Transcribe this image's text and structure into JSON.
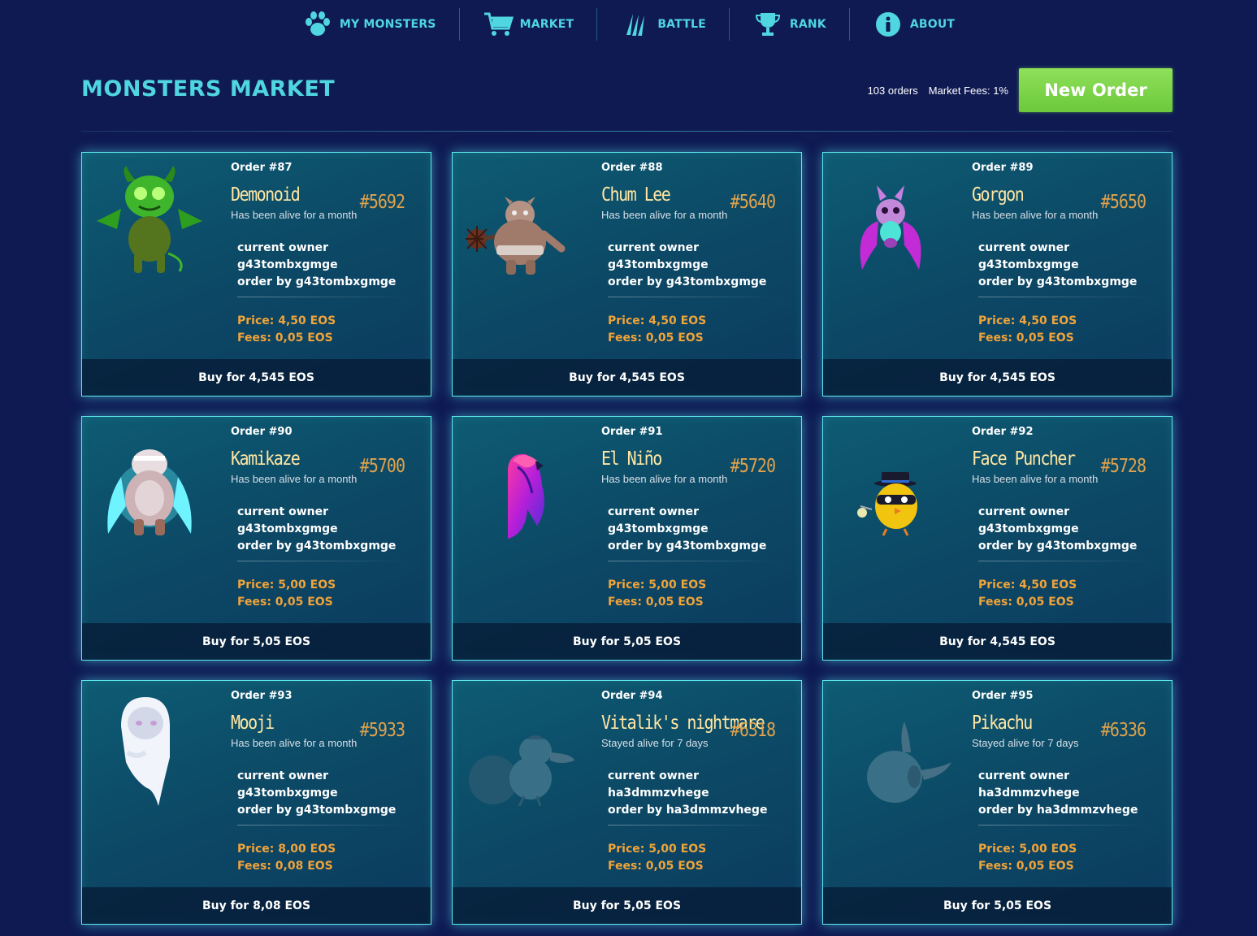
{
  "nav": {
    "items": [
      {
        "label": "MY MONSTERS",
        "icon": "paw-icon"
      },
      {
        "label": "MARKET",
        "icon": "cart-icon"
      },
      {
        "label": "BATTLE",
        "icon": "claw-icon"
      },
      {
        "label": "RANK",
        "icon": "trophy-icon"
      },
      {
        "label": "ABOUT",
        "icon": "info-icon"
      }
    ]
  },
  "header": {
    "title": "MONSTERS MARKET",
    "orders_count": "103 orders",
    "market_fees": "Market Fees: 1%",
    "new_order_label": "New Order"
  },
  "colors": {
    "background": "#0f1a52",
    "accent": "#4fd6e0",
    "name": "#ffe6a3",
    "price": "#f0a43a",
    "button": "#7ed44a"
  },
  "cards": [
    {
      "order": "Order #87",
      "name": "Demonoid",
      "id": "#5692",
      "alive": "Has been alive for a month",
      "owner_label": "current owner",
      "owner": "g43tombxgmge",
      "order_by": "order by g43tombxgmge",
      "price": "Price: 4,50 EOS",
      "fees": "Fees: 0,05 EOS",
      "buy": "Buy for 4,545 EOS",
      "art": "green-demon-monster"
    },
    {
      "order": "Order #88",
      "name": "Chum Lee",
      "id": "#5640",
      "alive": "Has been alive for a month",
      "owner_label": "current owner",
      "owner": "g43tombxgmge",
      "order_by": "order by g43tombxgmge",
      "price": "Price: 4,50 EOS",
      "fees": "Fees: 0,05 EOS",
      "buy": "Buy for 4,545 EOS",
      "art": "ogre-mace-monster"
    },
    {
      "order": "Order #89",
      "name": "Gorgon",
      "id": "#5650",
      "alive": "Has been alive for a month",
      "owner_label": "current owner",
      "owner": "g43tombxgmge",
      "order_by": "order by g43tombxgmge",
      "price": "Price: 4,50 EOS",
      "fees": "Fees: 0,05 EOS",
      "buy": "Buy for 4,545 EOS",
      "art": "purple-bat-monster"
    },
    {
      "order": "Order #90",
      "name": "Kamikaze",
      "id": "#5700",
      "alive": "Has been alive for a month",
      "owner_label": "current owner",
      "owner": "g43tombxgmge",
      "order_by": "order by g43tombxgmge",
      "price": "Price: 5,00 EOS",
      "fees": "Fees: 0,05 EOS",
      "buy": "Buy for 5,05 EOS",
      "art": "glowing-bear-monster"
    },
    {
      "order": "Order #91",
      "name": "El Niño",
      "id": "#5720",
      "alive": "Has been alive for a month",
      "owner_label": "current owner",
      "owner": "g43tombxgmge",
      "order_by": "order by g43tombxgmge",
      "price": "Price: 5,00 EOS",
      "fees": "Fees: 0,05 EOS",
      "buy": "Buy for 5,05 EOS",
      "art": "flame-bird-monster"
    },
    {
      "order": "Order #92",
      "name": "Face Puncher",
      "id": "#5728",
      "alive": "Has been alive for a month",
      "owner_label": "current owner",
      "owner": "g43tombxgmge",
      "order_by": "order by g43tombxgmge",
      "price": "Price: 4,50 EOS",
      "fees": "Fees: 0,05 EOS",
      "buy": "Buy for 4,545 EOS",
      "art": "masked-chick-monster"
    },
    {
      "order": "Order #93",
      "name": "Mooji",
      "id": "#5933",
      "alive": "Has been alive for a month",
      "owner_label": "current owner",
      "owner": "g43tombxgmge",
      "order_by": "order by g43tombxgmge",
      "price": "Price: 8,00 EOS",
      "fees": "Fees: 0,08 EOS",
      "buy": "Buy for 8,08 EOS",
      "art": "white-ghost-monster"
    },
    {
      "order": "Order #94",
      "name": "Vitalik's nightmare",
      "id": "#6318",
      "alive": "Stayed alive for 7 days",
      "owner_label": "current owner",
      "owner": "ha3dmmzvhege",
      "order_by": "order by ha3dmmzvhege",
      "price": "Price: 5,00 EOS",
      "fees": "Fees: 0,05 EOS",
      "buy": "Buy for 5,05 EOS",
      "art": "faded-duck-monster"
    },
    {
      "order": "Order #95",
      "name": "Pikachu",
      "id": "#6336",
      "alive": "Stayed alive for 7 days",
      "owner_label": "current owner",
      "owner": "ha3dmmzvhege",
      "order_by": "order by ha3dmmzvhege",
      "price": "Price: 5,00 EOS",
      "fees": "Fees: 0,05 EOS",
      "buy": "Buy for 5,05 EOS",
      "art": "faded-blob-monster"
    }
  ]
}
